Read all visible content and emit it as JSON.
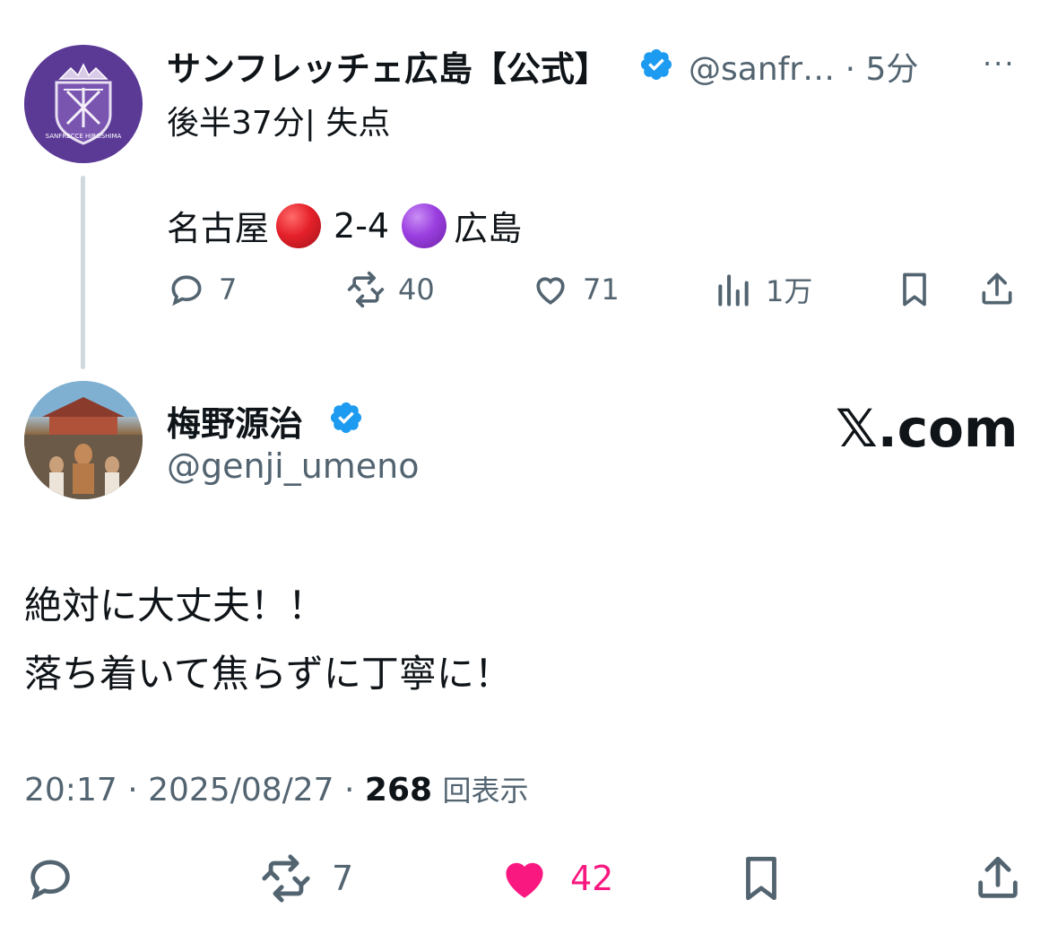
{
  "quoted_tweet": {
    "display_name": "サンフレッチェ広島【公式】",
    "handle": "@sanfr…",
    "time": "· 5分",
    "more": "···",
    "text_line1": "後半37分| 失点",
    "score_home": "名古屋",
    "score": "2-4",
    "score_away": "広島",
    "team_colors": {
      "home": "#e5212b",
      "away": "#9b3fe0"
    },
    "actions": {
      "replies": "7",
      "retweets": "40",
      "likes": "71",
      "views": "1万"
    },
    "avatar": {
      "crest_text": "SANFRECCE HIROSHIMA",
      "color": "#5b3a96"
    }
  },
  "main_tweet": {
    "display_name": "梅野源治",
    "handle": "@genji_umeno",
    "brand": "𝕏.com",
    "body_lines": [
      "絶対に大丈夫！！",
      "落ち着いて焦らずに丁寧に！"
    ],
    "timestamp": "20:17 · 2025/08/27 ·",
    "view_count": "268",
    "view_label": "回表示",
    "actions": {
      "retweets": "7",
      "likes": "42"
    },
    "colors": {
      "like": "#f91880",
      "verified": "#1d9bf0"
    }
  }
}
